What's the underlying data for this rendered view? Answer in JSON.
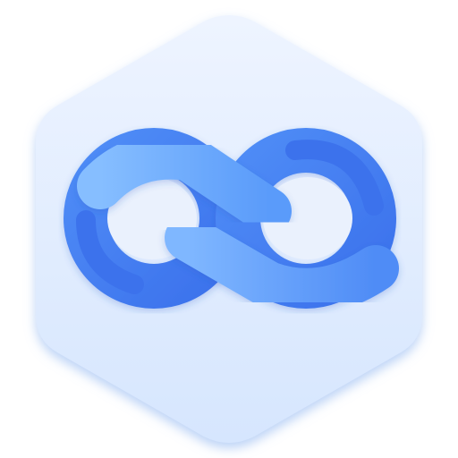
{
  "icon": {
    "name": "infinity-loop-icon",
    "shape": "hexagon",
    "colors": {
      "background_top": "#EEF4FF",
      "background_bottom": "#D6E6FE",
      "shadow": "#8FB5F0",
      "loop_dark": "#3C72EC",
      "loop_mid": "#4F8CF6",
      "loop_light": "#86BEFF",
      "hole_fill": "#EAF1FD"
    }
  }
}
